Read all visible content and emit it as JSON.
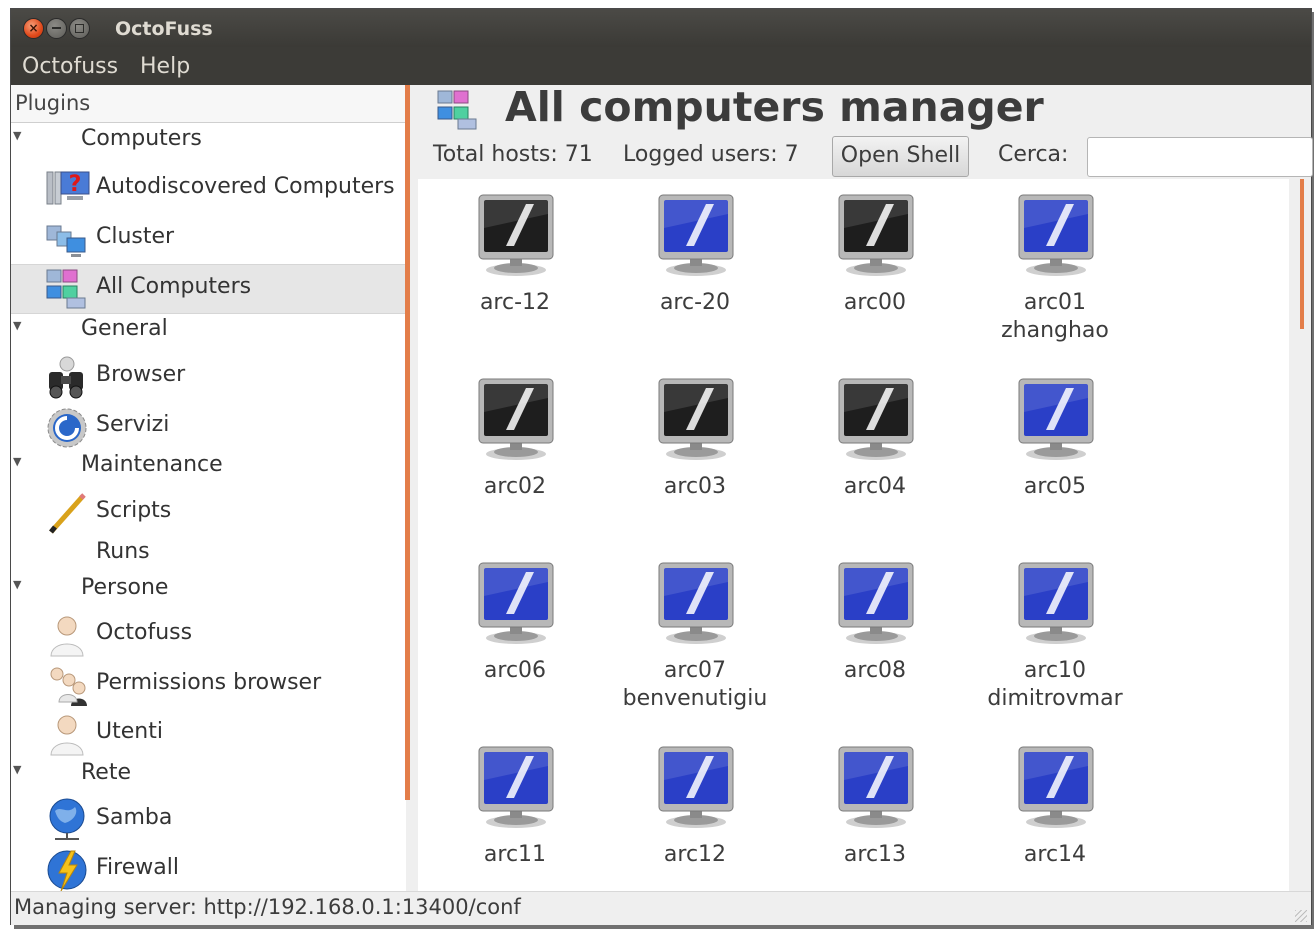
{
  "window": {
    "title": "OctoFuss",
    "close_glyph": "×"
  },
  "menubar": {
    "items": [
      "Octofuss",
      "Help"
    ]
  },
  "sidebar": {
    "header": "Plugins",
    "groups": [
      {
        "label": "Computers",
        "items": [
          {
            "label": "Autodiscovered Computers",
            "icon": "autodiscover-icon"
          },
          {
            "label": "Cluster",
            "icon": "cluster-icon"
          },
          {
            "label": "All Computers",
            "icon": "all-computers-icon",
            "selected": true
          }
        ]
      },
      {
        "label": "General",
        "items": [
          {
            "label": "Browser",
            "icon": "binoculars-icon"
          },
          {
            "label": "Servizi",
            "icon": "services-gear-icon"
          }
        ]
      },
      {
        "label": "Maintenance",
        "items": [
          {
            "label": "Scripts",
            "icon": "pencil-icon"
          },
          {
            "label": "Runs",
            "icon": ""
          }
        ]
      },
      {
        "label": "Persone",
        "items": [
          {
            "label": "Octofuss",
            "icon": "user-icon"
          },
          {
            "label": "Permissions browser",
            "icon": "users-group-icon"
          },
          {
            "label": "Utenti",
            "icon": "user-icon"
          }
        ]
      },
      {
        "label": "Rete",
        "items": [
          {
            "label": "Samba",
            "icon": "globe-network-icon"
          },
          {
            "label": "Firewall",
            "icon": "globe-lightning-icon"
          }
        ]
      }
    ]
  },
  "content": {
    "title": "All computers manager",
    "total_hosts": "Total hosts: 71",
    "logged_users": "Logged users: 7",
    "open_shell_label": "Open Shell",
    "search_label": "Cerca:",
    "search_value": "",
    "hosts": [
      {
        "name": "arc-12",
        "user": "",
        "online": false
      },
      {
        "name": "arc-20",
        "user": "",
        "online": true
      },
      {
        "name": "arc00",
        "user": "",
        "online": false
      },
      {
        "name": "arc01",
        "user": "zhanghao",
        "online": true
      },
      {
        "name": "arc02",
        "user": "",
        "online": false
      },
      {
        "name": "arc03",
        "user": "",
        "online": false
      },
      {
        "name": "arc04",
        "user": "",
        "online": false
      },
      {
        "name": "arc05",
        "user": "",
        "online": true
      },
      {
        "name": "arc06",
        "user": "",
        "online": true
      },
      {
        "name": "arc07",
        "user": "benvenutigiu",
        "online": true
      },
      {
        "name": "arc08",
        "user": "",
        "online": true
      },
      {
        "name": "arc10",
        "user": "dimitrovmar",
        "online": true
      },
      {
        "name": "arc11",
        "user": "",
        "online": true
      },
      {
        "name": "arc12",
        "user": "",
        "online": true
      },
      {
        "name": "arc13",
        "user": "",
        "online": true
      },
      {
        "name": "arc14",
        "user": "",
        "online": true
      }
    ]
  },
  "statusbar": {
    "text": "Managing server: http://192.168.0.1:13400/conf"
  },
  "colors": {
    "accent": "#e37d49",
    "titlebar": "#3c3b37",
    "monitor_online": "#2a3fc7",
    "monitor_offline": "#1e1e1e"
  }
}
